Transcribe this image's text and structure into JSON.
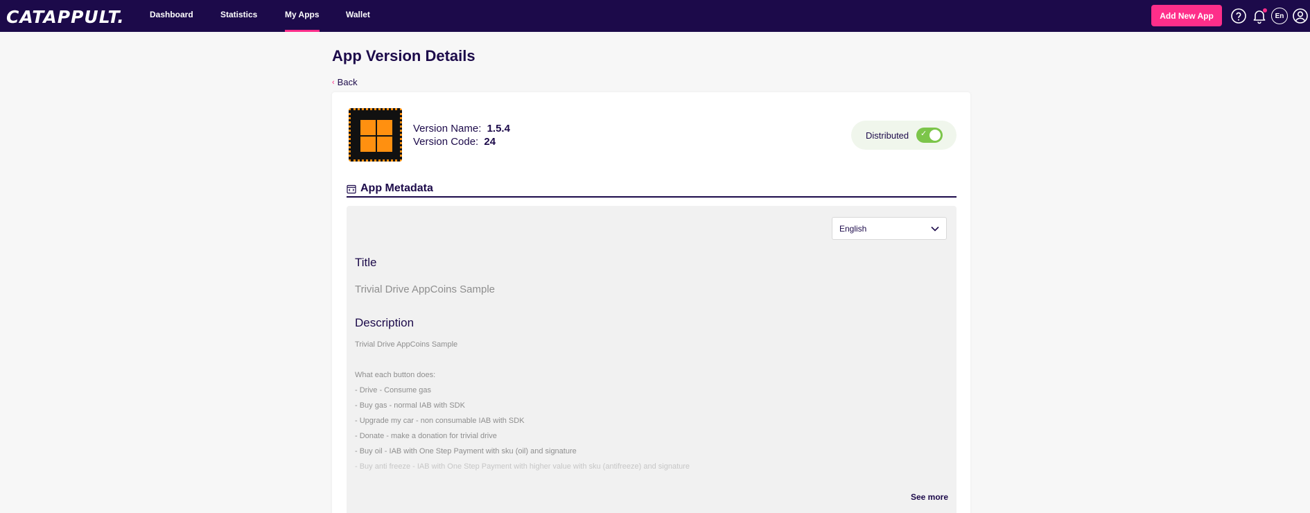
{
  "nav": {
    "logo": "CATAPPULT.",
    "links": [
      "Dashboard",
      "Statistics",
      "My Apps",
      "Wallet"
    ],
    "active": "My Apps",
    "add_button": "Add New App",
    "icons": [
      "help-icon",
      "bell-icon",
      "language-icon",
      "account-icon"
    ],
    "language_short": "En"
  },
  "page": {
    "title": "App Version Details",
    "back": "Back"
  },
  "version": {
    "name_label": "Version Name:",
    "name_value": "1.5.4",
    "code_label": "Version Code:",
    "code_value": "24",
    "distributed_label": "Distributed",
    "distributed_on": true
  },
  "metadata": {
    "heading": "App Metadata",
    "language": "English",
    "title_label": "Title",
    "title_value": "Trivial Drive AppCoins Sample",
    "description_label": "Description",
    "description_lines": [
      " Trivial Drive AppCoins Sample",
      "What each button does:",
      "- Drive - Consume gas",
      "- Buy gas - normal IAB with SDK",
      "- Upgrade my car - non consumable IAB with SDK",
      "- Donate - make a donation for trivial drive",
      "- Buy oil - IAB with One Step Payment with sku (oil) and signature",
      "- Buy anti freeze - IAB with One Step Payment with higher value with sku (antifreeze) and signature"
    ],
    "see_more": "See more"
  },
  "colors": {
    "nav_bg": "#1c0a4a",
    "accent": "#fe2e8a",
    "toggle_on": "#7cc54a",
    "app_icon": "#ff9010"
  }
}
